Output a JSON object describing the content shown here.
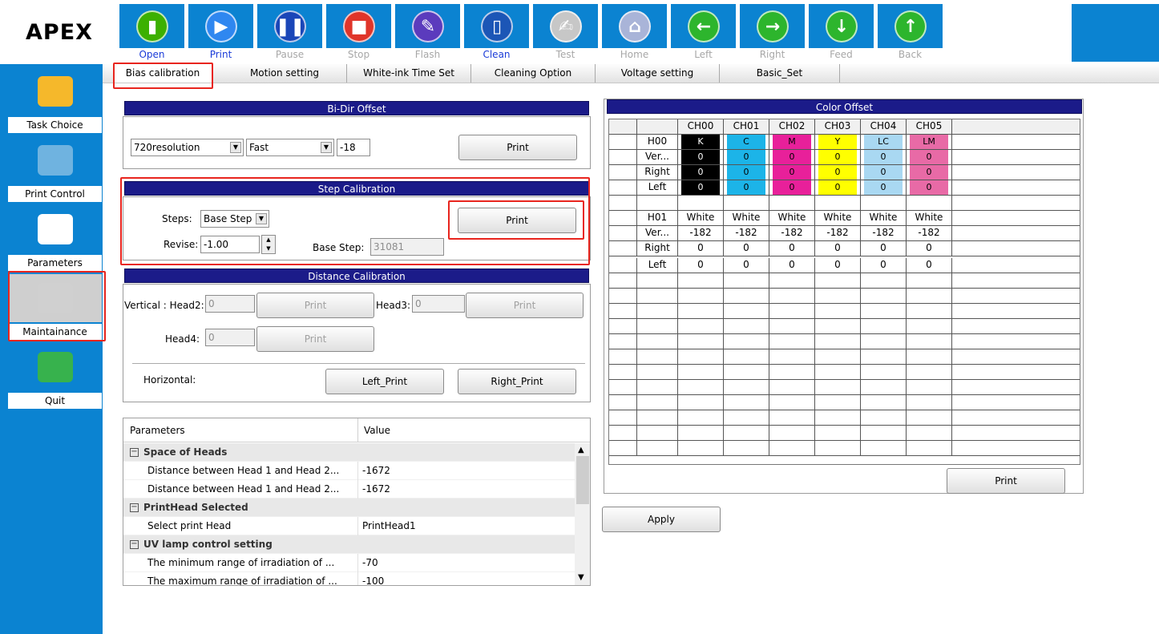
{
  "app": {
    "logo": "APEX"
  },
  "toolbar": [
    {
      "label": "Open",
      "enabled": true,
      "icon": "folder-open-icon",
      "color": "#3cb000",
      "glyph": "▮"
    },
    {
      "label": "Print",
      "enabled": true,
      "icon": "play-icon",
      "color": "#2f87f0",
      "glyph": "▶"
    },
    {
      "label": "Pause",
      "enabled": false,
      "icon": "pause-icon",
      "color": "#1a46b8",
      "glyph": "❚❚"
    },
    {
      "label": "Stop",
      "enabled": false,
      "icon": "stop-icon",
      "color": "#e0352a",
      "glyph": "■"
    },
    {
      "label": "Flash",
      "enabled": false,
      "icon": "ink-flash-icon",
      "color": "#5b3bbd",
      "glyph": "✎"
    },
    {
      "label": "Clean",
      "enabled": true,
      "icon": "clean-bottle-icon",
      "color": "#1c56b6",
      "glyph": "▯"
    },
    {
      "label": "Test",
      "enabled": false,
      "icon": "test-document-icon",
      "color": "#c7c7c7",
      "glyph": "✍"
    },
    {
      "label": "Home",
      "enabled": false,
      "icon": "home-icon",
      "color": "#a9b4d8",
      "glyph": "⌂"
    },
    {
      "label": "Left",
      "enabled": false,
      "icon": "arrow-left-icon",
      "color": "#2db52d",
      "glyph": "←"
    },
    {
      "label": "Right",
      "enabled": false,
      "icon": "arrow-right-icon",
      "color": "#2db52d",
      "glyph": "→"
    },
    {
      "label": "Feed",
      "enabled": false,
      "icon": "arrow-down-icon",
      "color": "#2db52d",
      "glyph": "↓"
    },
    {
      "label": "Back",
      "enabled": false,
      "icon": "arrow-up-icon",
      "color": "#2db52d",
      "glyph": "↑"
    }
  ],
  "sidebar": [
    {
      "label": "Task Choice",
      "icon": "folder-icon"
    },
    {
      "label": "Print Control",
      "icon": "print-control-icon"
    },
    {
      "label": "Parameters",
      "icon": "gear-icon"
    },
    {
      "label": "Maintainance",
      "icon": "tools-icon",
      "highlighted": true
    },
    {
      "label": "Quit",
      "icon": "quit-user-icon"
    }
  ],
  "tabs": [
    "Bias calibration",
    "Motion setting",
    "White-ink Time Set",
    "Cleaning Option",
    "Voltage setting",
    "Basic_Set"
  ],
  "bidir": {
    "title": "Bi-Dir Offset",
    "resolution": "720resolution",
    "speed": "Fast",
    "value": "-18",
    "print_label": "Print"
  },
  "step": {
    "title": "Step Calibration",
    "steps_label": "Steps:",
    "steps_value": "Base Step",
    "revise_label": "Revise:",
    "revise_value": "-1.00",
    "base_step_label": "Base Step:",
    "base_step_value": "31081",
    "print_label": "Print"
  },
  "distance": {
    "title": "Distance  Calibration",
    "vertical_head2_label": "Vertical : Head2:",
    "head2_value": "0",
    "head3_label": "Head3:",
    "head3_value": "0",
    "head4_label": "Head4:",
    "head4_value": "0",
    "print_label": "Print",
    "horizontal_label": "Horizontal:",
    "left_print": "Left_Print",
    "right_print": "Right_Print"
  },
  "params": {
    "col_parameters": "Parameters",
    "col_value": "Value",
    "rows": [
      {
        "type": "cat",
        "key": "Space of Heads"
      },
      {
        "type": "item",
        "key": "Distance between Head 1 and Head 2...",
        "value": "-1672"
      },
      {
        "type": "item",
        "key": "Distance between Head 1 and Head 2...",
        "value": "-1672"
      },
      {
        "type": "cat",
        "key": "PrintHead Selected"
      },
      {
        "type": "item",
        "key": "Select print Head",
        "value": "PrintHead1"
      },
      {
        "type": "cat",
        "key": "UV lamp control setting"
      },
      {
        "type": "item",
        "key": "The minimum range of irradiation of ...",
        "value": "-70"
      },
      {
        "type": "item",
        "key": "The maximum range of irradiation of ...",
        "value": "-100"
      }
    ]
  },
  "color_offset": {
    "title": "Color Offset",
    "channels": [
      "CH00",
      "CH01",
      "CH02",
      "CH03",
      "CH04",
      "CH05"
    ],
    "h00": {
      "label": "H00",
      "colors": [
        "K",
        "C",
        "M",
        "Y",
        "LC",
        "LM"
      ],
      "swatches": [
        "#000000",
        "#1cb4e8",
        "#e8209a",
        "#ffff00",
        "#a9d8f2",
        "#e86aa6"
      ],
      "rows": [
        {
          "label": "Ver...",
          "values": [
            "0",
            "0",
            "0",
            "0",
            "0",
            "0"
          ]
        },
        {
          "label": "Right",
          "values": [
            "0",
            "0",
            "0",
            "0",
            "0",
            "0"
          ]
        },
        {
          "label": "Left",
          "values": [
            "0",
            "0",
            "0",
            "0",
            "0",
            "0"
          ]
        }
      ]
    },
    "h01": {
      "label": "H01",
      "colors": [
        "White",
        "White",
        "White",
        "White",
        "White",
        "White"
      ],
      "rows": [
        {
          "label": "Ver...",
          "values": [
            "-182",
            "-182",
            "-182",
            "-182",
            "-182",
            "-182"
          ]
        },
        {
          "label": "Right",
          "values": [
            "0",
            "0",
            "0",
            "0",
            "0",
            "0"
          ]
        },
        {
          "label": "Left",
          "values": [
            "0",
            "0",
            "0",
            "0",
            "0",
            "0"
          ]
        }
      ]
    },
    "print_label": "Print",
    "apply_label": "Apply"
  }
}
